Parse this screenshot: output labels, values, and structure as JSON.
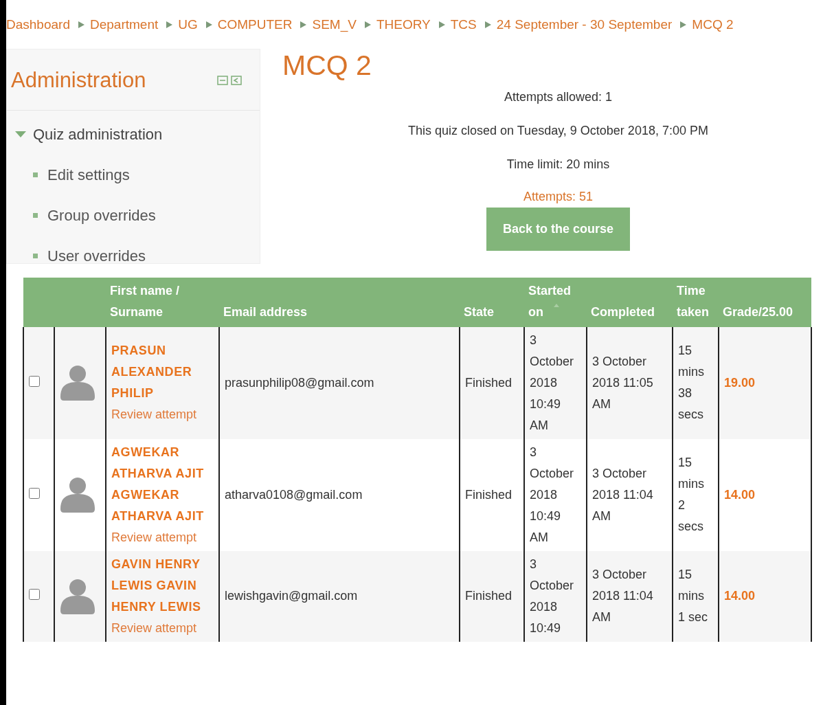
{
  "breadcrumb": [
    "Dashboard",
    "Department",
    "UG",
    "COMPUTER",
    "SEM_V",
    "THEORY",
    "TCS",
    "24 September - 30 September",
    "MCQ 2"
  ],
  "sidebar": {
    "title": "Administration",
    "section": {
      "label": "Quiz administration",
      "expanded": true,
      "items": [
        "Edit settings",
        "Group overrides",
        "User overrides"
      ]
    }
  },
  "heading": "MCQ 2",
  "info": [
    "Attempts allowed: 1",
    "This quiz closed on Tuesday, 9 October 2018, 7:00 PM",
    "Time limit: 20 mins"
  ],
  "attempts_link": "Attempts: 51",
  "back_button": "Back to the course",
  "table": {
    "columns": [
      "First name / Surname",
      "Email address",
      "State",
      "Started on",
      "Completed",
      "Time taken",
      "Grade/25.00"
    ],
    "rows": [
      {
        "checked": false,
        "name": "PRASUN ALEXANDER PHILIP",
        "review": "Review attempt",
        "email": "prasunphilip08@gmail.com",
        "state": "Finished",
        "started": "3 October 2018 10:49 AM",
        "completed": "3 October 2018 11:05 AM",
        "time_taken": "15 mins 38 secs",
        "grade": "19.00"
      },
      {
        "checked": false,
        "name": "AGWEKAR ATHARVA AJIT AGWEKAR ATHARVA AJIT",
        "review": "Review attempt",
        "email": "atharva0108@gmail.com",
        "state": "Finished",
        "started": "3 October 2018 10:49 AM",
        "completed": "3 October 2018 11:04 AM",
        "time_taken": "15 mins 2 secs",
        "grade": "14.00"
      },
      {
        "checked": false,
        "name": "GAVIN HENRY LEWIS GAVIN HENRY LEWIS",
        "review": "Review attempt",
        "email": "lewishgavin@gmail.com",
        "state": "Finished",
        "started": "3 October 2018 10:49",
        "completed": "3 October 2018 11:04 AM",
        "time_taken": "15 mins 1 sec",
        "grade": "14.00"
      }
    ]
  }
}
